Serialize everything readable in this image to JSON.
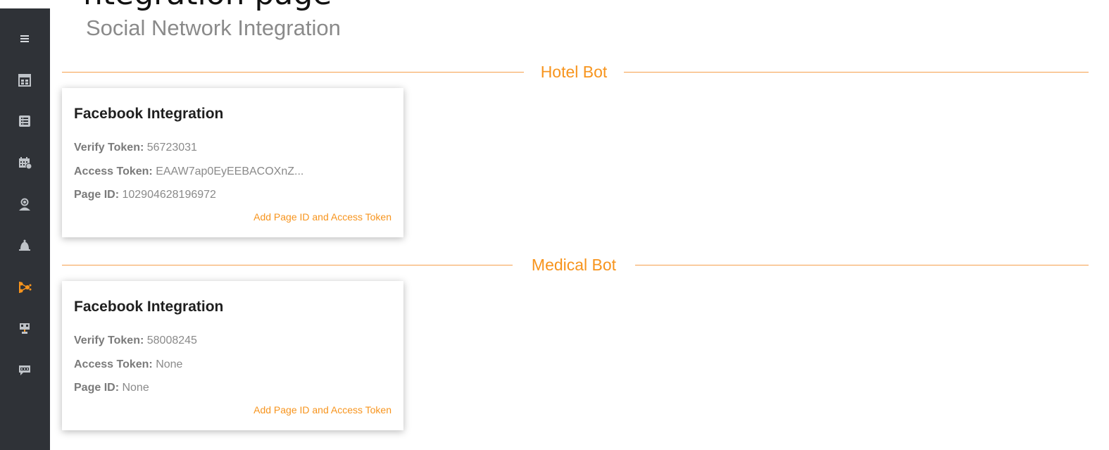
{
  "page": {
    "cropped_heading": "ntegration page",
    "title": "Social Network Integration"
  },
  "sidebar": {
    "items": [
      {
        "name": "menu-icon"
      },
      {
        "name": "dashboard-icon"
      },
      {
        "name": "list-icon"
      },
      {
        "name": "calendar-icon"
      },
      {
        "name": "agent-icon"
      },
      {
        "name": "bell-icon"
      },
      {
        "name": "integration-icon",
        "active": true
      },
      {
        "name": "training-icon"
      },
      {
        "name": "faq-icon"
      }
    ],
    "active_color": "#f7941d",
    "icon_color": "#bfc3c8",
    "background": "#2f3237"
  },
  "sections": [
    {
      "label": "Hotel Bot",
      "card": {
        "title": "Facebook Integration",
        "verify_label": "Verify Token:",
        "verify_value": "56723031",
        "access_label": "Access Token:",
        "access_value": "EAAW7ap0EyEEBACOXnZ...",
        "page_label": "Page ID:",
        "page_value": "102904628196972",
        "link": "Add Page ID and Access Token"
      }
    },
    {
      "label": "Medical Bot",
      "card": {
        "title": "Facebook Integration",
        "verify_label": "Verify Token:",
        "verify_value": "58008245",
        "access_label": "Access Token:",
        "access_value": "None",
        "page_label": "Page ID:",
        "page_value": "None",
        "link": "Add Page ID and Access Token"
      }
    }
  ],
  "accent_color": "#f7941d"
}
